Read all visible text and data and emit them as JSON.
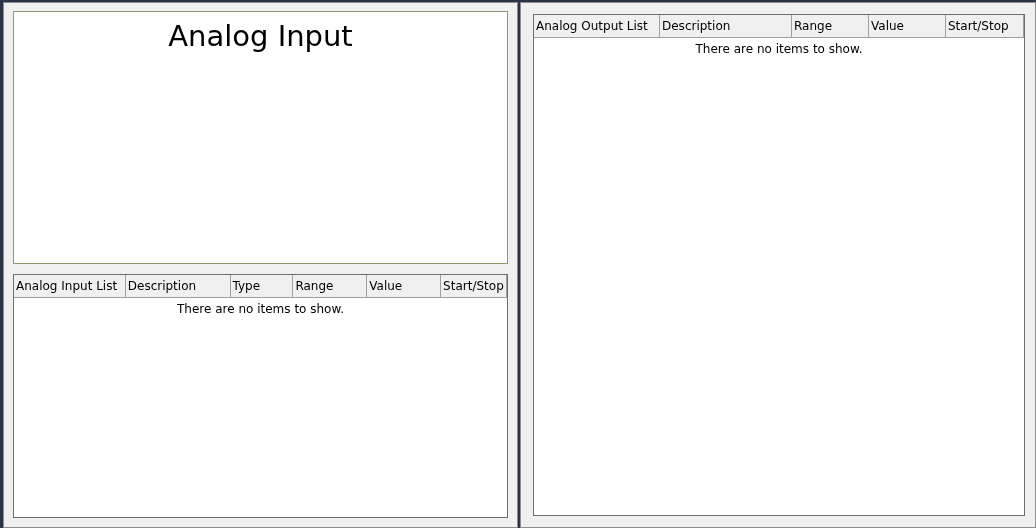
{
  "chart_panel": {
    "title": "Analog Input"
  },
  "input_list": {
    "columns": [
      "Analog Input List",
      "Description",
      "Type",
      "Range",
      "Value",
      "Start/Stop"
    ],
    "empty_text": "There are no items to show."
  },
  "output_list": {
    "columns": [
      "Analog Output List",
      "Description",
      "Range",
      "Value",
      "Start/Stop"
    ],
    "empty_text": "There are no items to show."
  }
}
